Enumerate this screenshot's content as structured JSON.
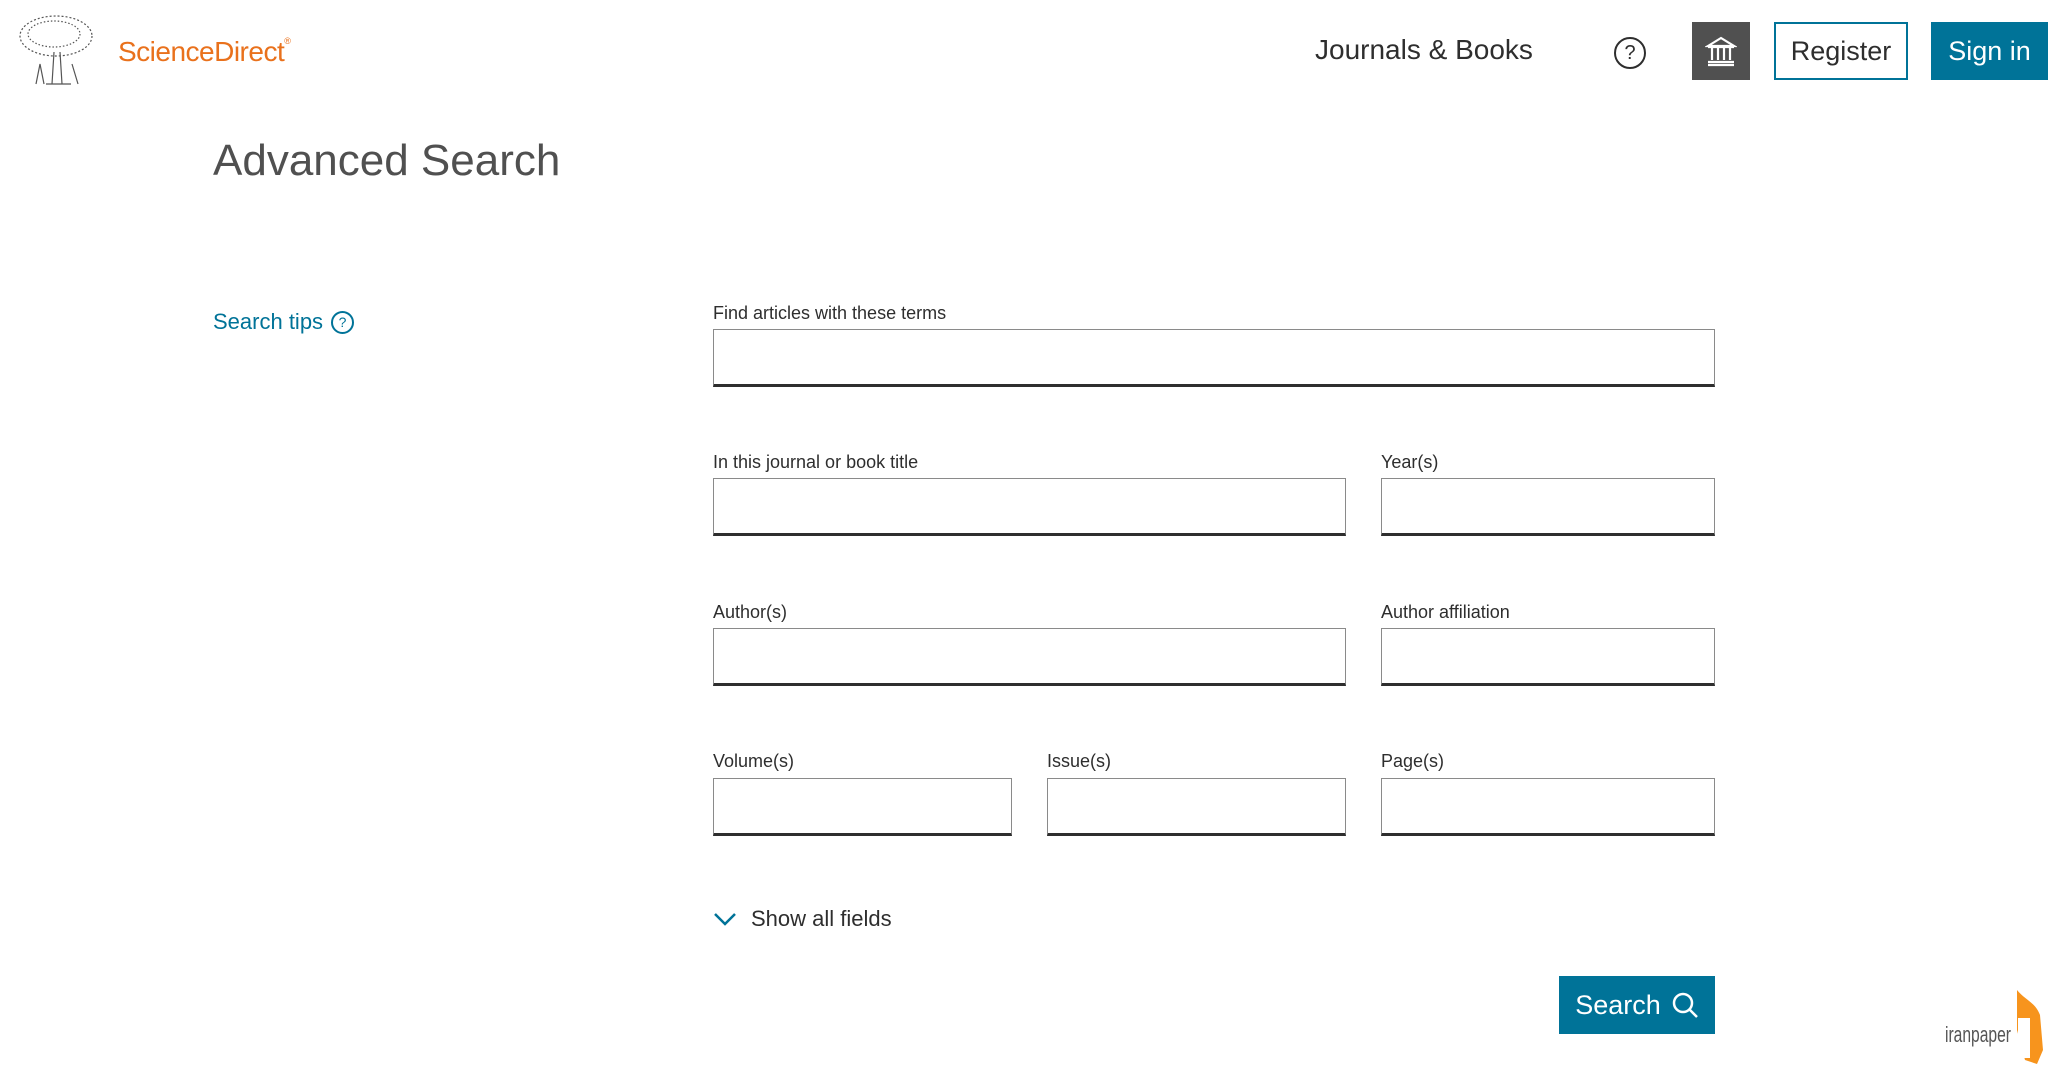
{
  "header": {
    "brand": "ScienceDirect",
    "brand_mark": "®",
    "nav_link": "Journals & Books",
    "help_icon": "question-circle-icon",
    "institution_icon": "institution-icon",
    "register_label": "Register",
    "signin_label": "Sign in"
  },
  "page": {
    "title": "Advanced Search",
    "search_tips": "Search tips"
  },
  "form": {
    "terms": {
      "label": "Find articles with these terms",
      "value": ""
    },
    "journal": {
      "label": "In this journal or book title",
      "value": ""
    },
    "years": {
      "label": "Year(s)",
      "value": ""
    },
    "authors": {
      "label": "Author(s)",
      "value": ""
    },
    "affiliation": {
      "label": "Author affiliation",
      "value": ""
    },
    "volumes": {
      "label": "Volume(s)",
      "value": ""
    },
    "issues": {
      "label": "Issue(s)",
      "value": ""
    },
    "pages": {
      "label": "Page(s)",
      "value": ""
    },
    "show_all": "Show all fields",
    "search_label": "Search"
  },
  "watermark": {
    "text": "iranpaper"
  },
  "colors": {
    "accent": "#007398",
    "brand": "#e9711c",
    "institution_button": "#505050"
  }
}
